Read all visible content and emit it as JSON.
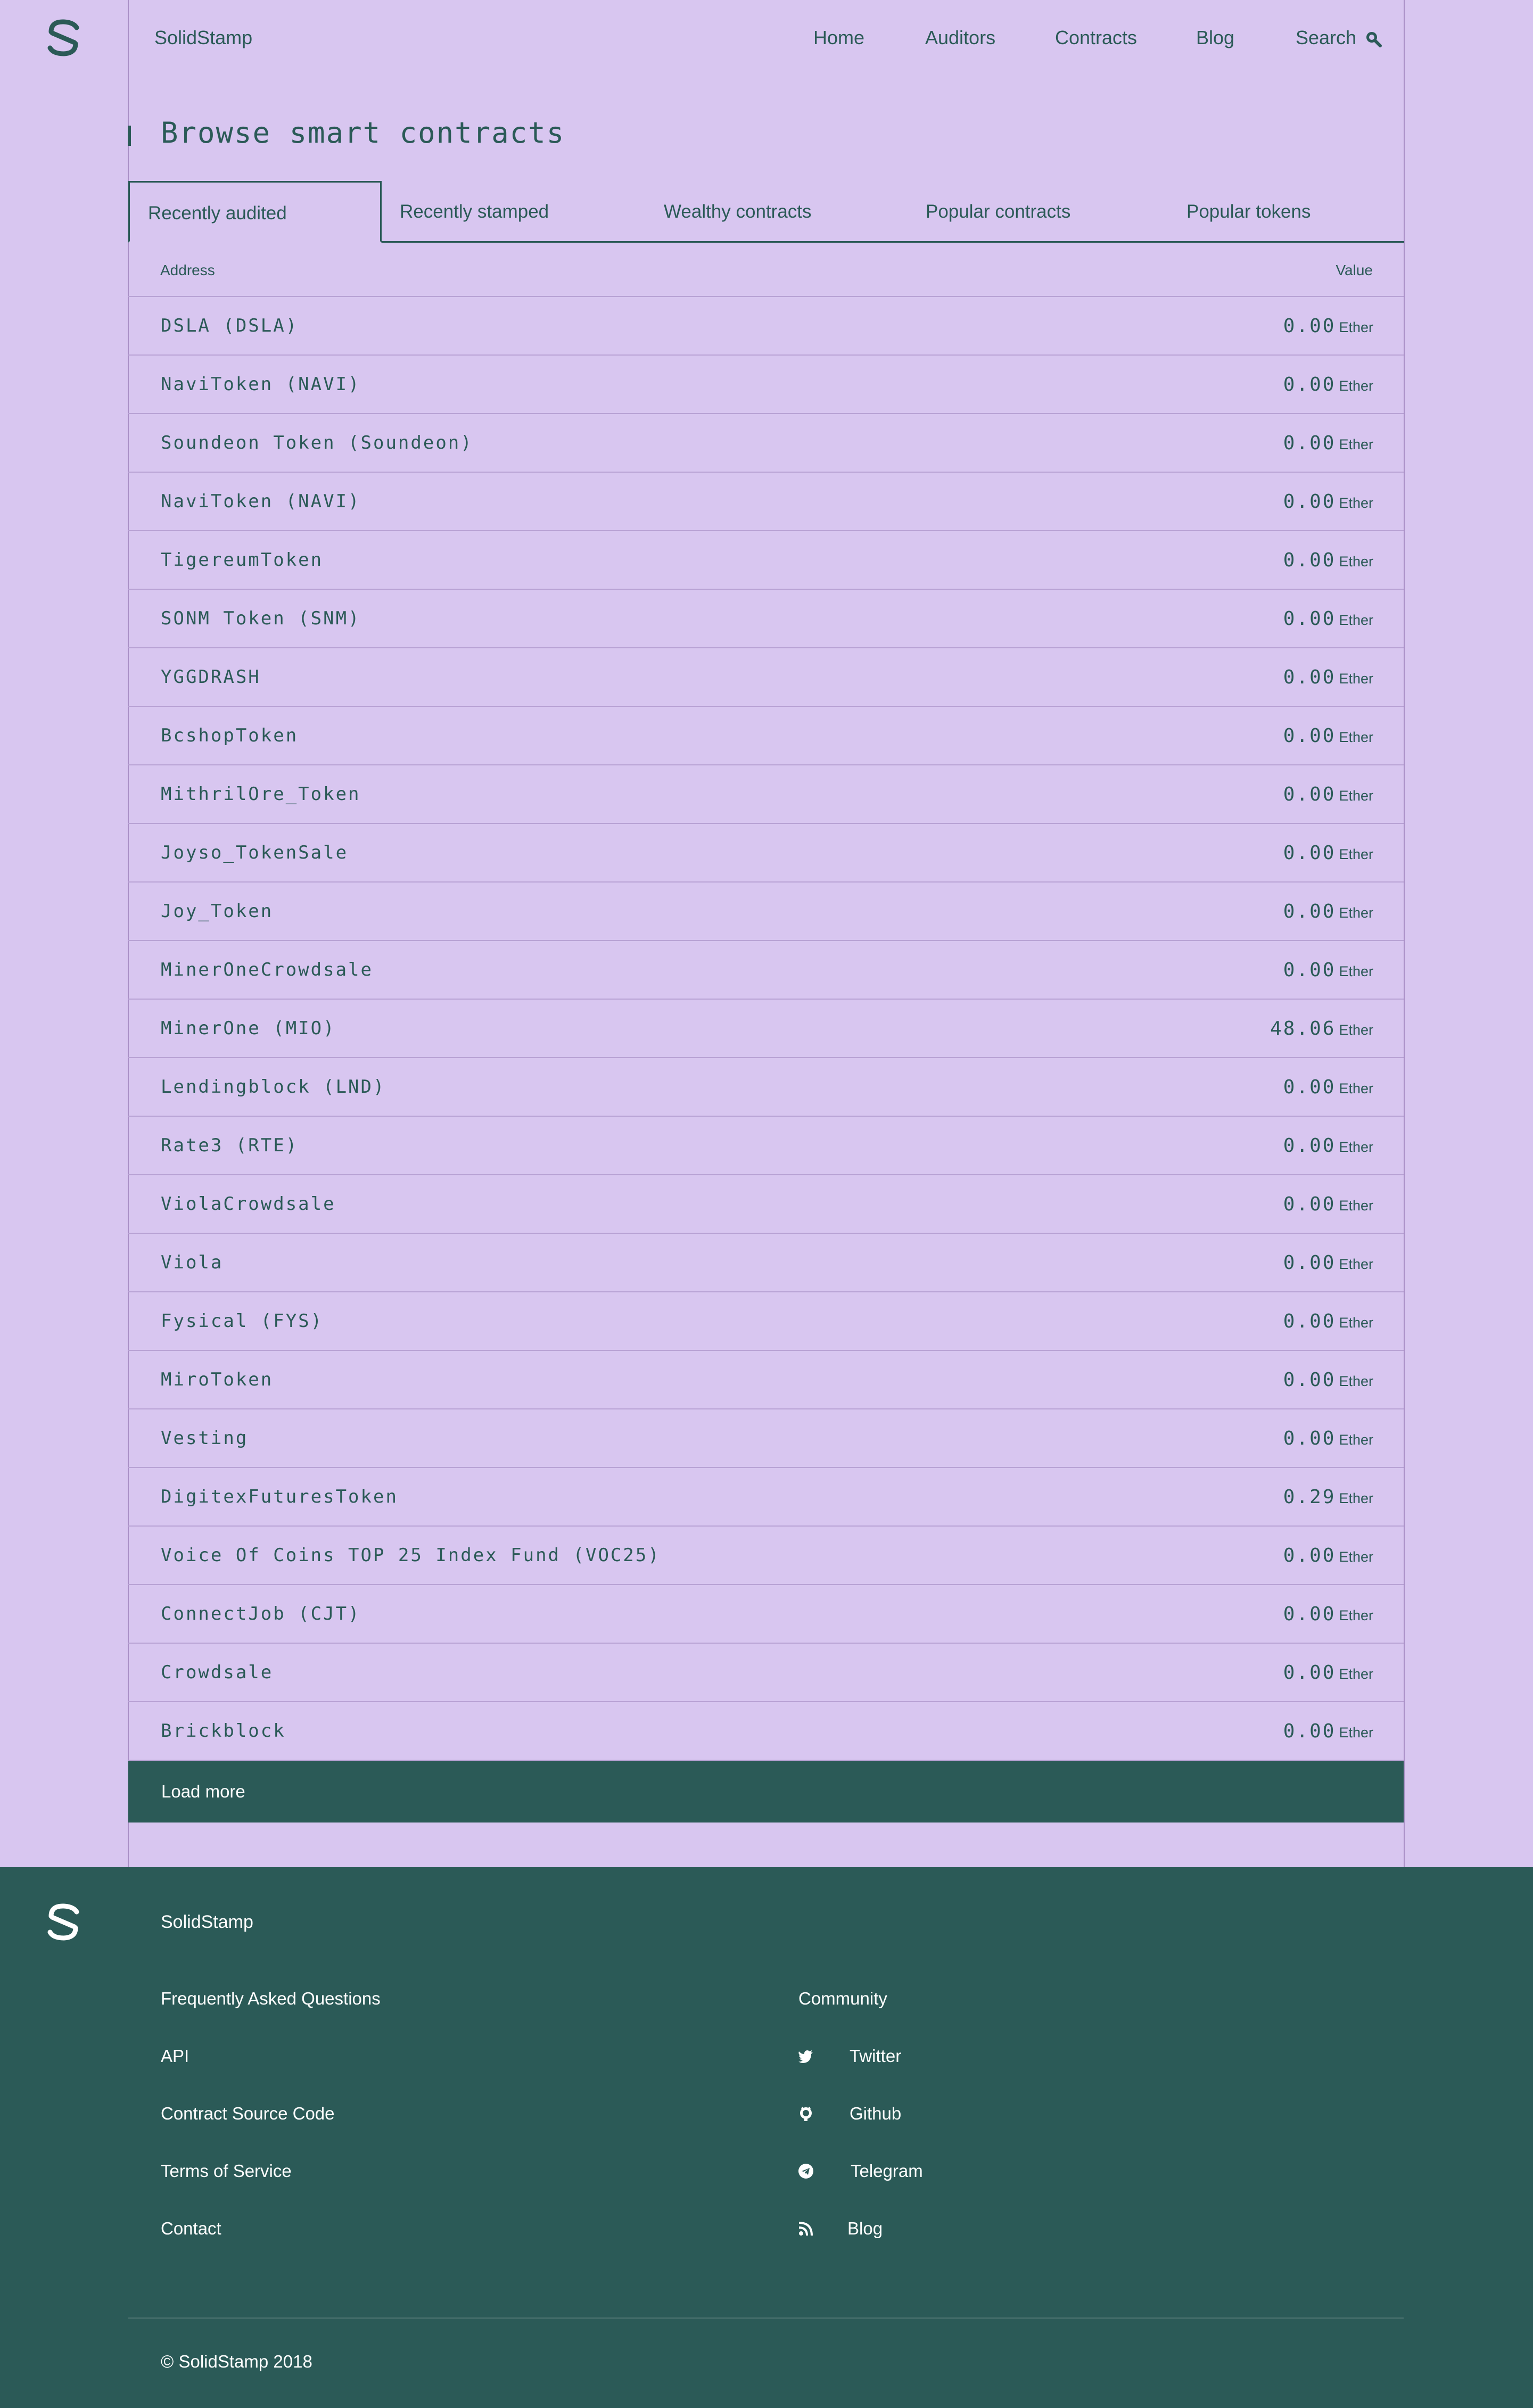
{
  "header": {
    "brand": "SolidStamp",
    "nav": [
      "Home",
      "Auditors",
      "Contracts",
      "Blog"
    ],
    "search_label": "Search"
  },
  "main": {
    "title": "Browse smart contracts",
    "tabs": [
      "Recently audited",
      "Recently stamped",
      "Wealthy contracts",
      "Popular contracts",
      "Popular tokens"
    ],
    "active_tab": "Recently audited",
    "columns": {
      "address": "Address",
      "value": "Value"
    },
    "rows": [
      {
        "name": "DSLA (DSLA)",
        "value": "0.00",
        "unit": "Ether"
      },
      {
        "name": "NaviToken (NAVI)",
        "value": "0.00",
        "unit": "Ether"
      },
      {
        "name": "Soundeon Token (Soundeon)",
        "value": "0.00",
        "unit": "Ether"
      },
      {
        "name": "NaviToken (NAVI)",
        "value": "0.00",
        "unit": "Ether"
      },
      {
        "name": "TigereumToken",
        "value": "0.00",
        "unit": "Ether"
      },
      {
        "name": "SONM Token (SNM)",
        "value": "0.00",
        "unit": "Ether"
      },
      {
        "name": "YGGDRASH",
        "value": "0.00",
        "unit": "Ether"
      },
      {
        "name": "BcshopToken",
        "value": "0.00",
        "unit": "Ether"
      },
      {
        "name": "MithrilOre_Token",
        "value": "0.00",
        "unit": "Ether"
      },
      {
        "name": "Joyso_TokenSale",
        "value": "0.00",
        "unit": "Ether"
      },
      {
        "name": "Joy_Token",
        "value": "0.00",
        "unit": "Ether"
      },
      {
        "name": "MinerOneCrowdsale",
        "value": "0.00",
        "unit": "Ether"
      },
      {
        "name": "MinerOne (MIO)",
        "value": "48.06",
        "unit": "Ether"
      },
      {
        "name": "Lendingblock (LND)",
        "value": "0.00",
        "unit": "Ether"
      },
      {
        "name": "Rate3 (RTE)",
        "value": "0.00",
        "unit": "Ether"
      },
      {
        "name": "ViolaCrowdsale",
        "value": "0.00",
        "unit": "Ether"
      },
      {
        "name": "Viola",
        "value": "0.00",
        "unit": "Ether"
      },
      {
        "name": "Fysical (FYS)",
        "value": "0.00",
        "unit": "Ether"
      },
      {
        "name": "MiroToken",
        "value": "0.00",
        "unit": "Ether"
      },
      {
        "name": "Vesting",
        "value": "0.00",
        "unit": "Ether"
      },
      {
        "name": "DigitexFuturesToken",
        "value": "0.29",
        "unit": "Ether"
      },
      {
        "name": "Voice Of Coins TOP 25 Index Fund (VOC25)",
        "value": "0.00",
        "unit": "Ether"
      },
      {
        "name": "ConnectJob (CJT)",
        "value": "0.00",
        "unit": "Ether"
      },
      {
        "name": "Crowdsale",
        "value": "0.00",
        "unit": "Ether"
      },
      {
        "name": "Brickblock",
        "value": "0.00",
        "unit": "Ether"
      }
    ],
    "load_more": "Load more"
  },
  "footer": {
    "brand": "SolidStamp",
    "links": [
      "Frequently Asked Questions",
      "API",
      "Contract Source Code",
      "Terms of Service",
      "Contact"
    ],
    "community_title": "Community",
    "community": [
      {
        "label": "Twitter",
        "icon": "twitter-icon"
      },
      {
        "label": "Github",
        "icon": "github-icon"
      },
      {
        "label": "Telegram",
        "icon": "telegram-icon"
      },
      {
        "label": "Blog",
        "icon": "rss-icon"
      }
    ],
    "copyright": "© SolidStamp 2018"
  },
  "colors": {
    "background": "#d8c6f0",
    "accent": "#2b5a57",
    "footer_text": "#ffffff"
  }
}
